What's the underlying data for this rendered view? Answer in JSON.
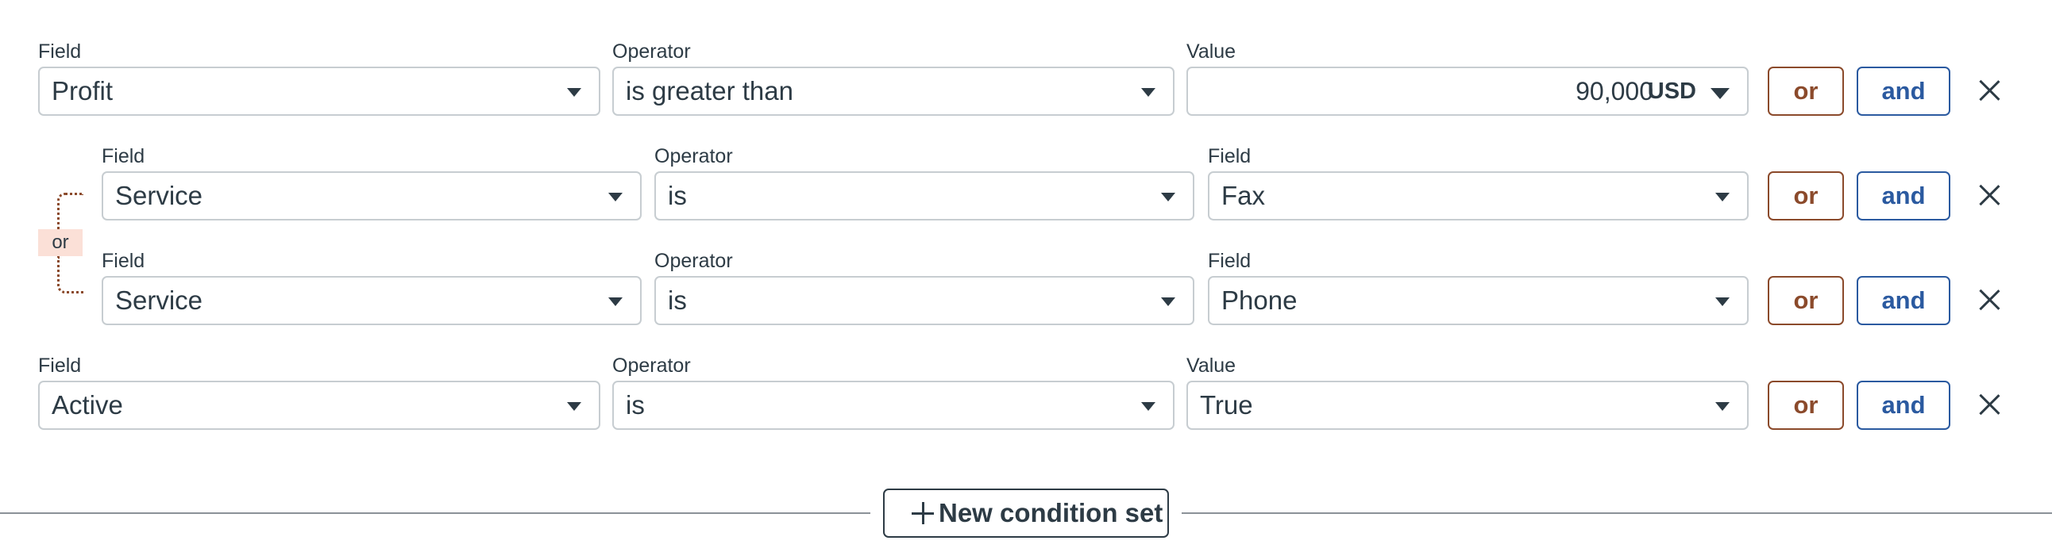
{
  "rows": [
    {
      "field_label": "Field",
      "field_value": "Profit",
      "operator_label": "Operator",
      "operator_value": "is greater than",
      "value_label": "Value",
      "value_amount": "90,000",
      "value_currency": "USD",
      "or_label": "or",
      "and_label": "and"
    },
    {
      "field_label": "Field",
      "field_value": "Service",
      "operator_label": "Operator",
      "operator_value": "is",
      "value_label": "Field",
      "value_value": "Fax",
      "or_label": "or",
      "and_label": "and"
    },
    {
      "field_label": "Field",
      "field_value": "Service",
      "operator_label": "Operator",
      "operator_value": "is",
      "value_label": "Field",
      "value_value": "Phone",
      "or_label": "or",
      "and_label": "and"
    },
    {
      "field_label": "Field",
      "field_value": "Active",
      "operator_label": "Operator",
      "operator_value": "is",
      "value_label": "Value",
      "value_value": "True",
      "or_label": "or",
      "and_label": "and"
    }
  ],
  "group_connector": "or",
  "new_condition_set_label": "New condition set",
  "colors": {
    "or_accent": "#8b4a2b",
    "and_accent": "#2b5aa0",
    "or_chip_bg": "#fbe0d7"
  }
}
